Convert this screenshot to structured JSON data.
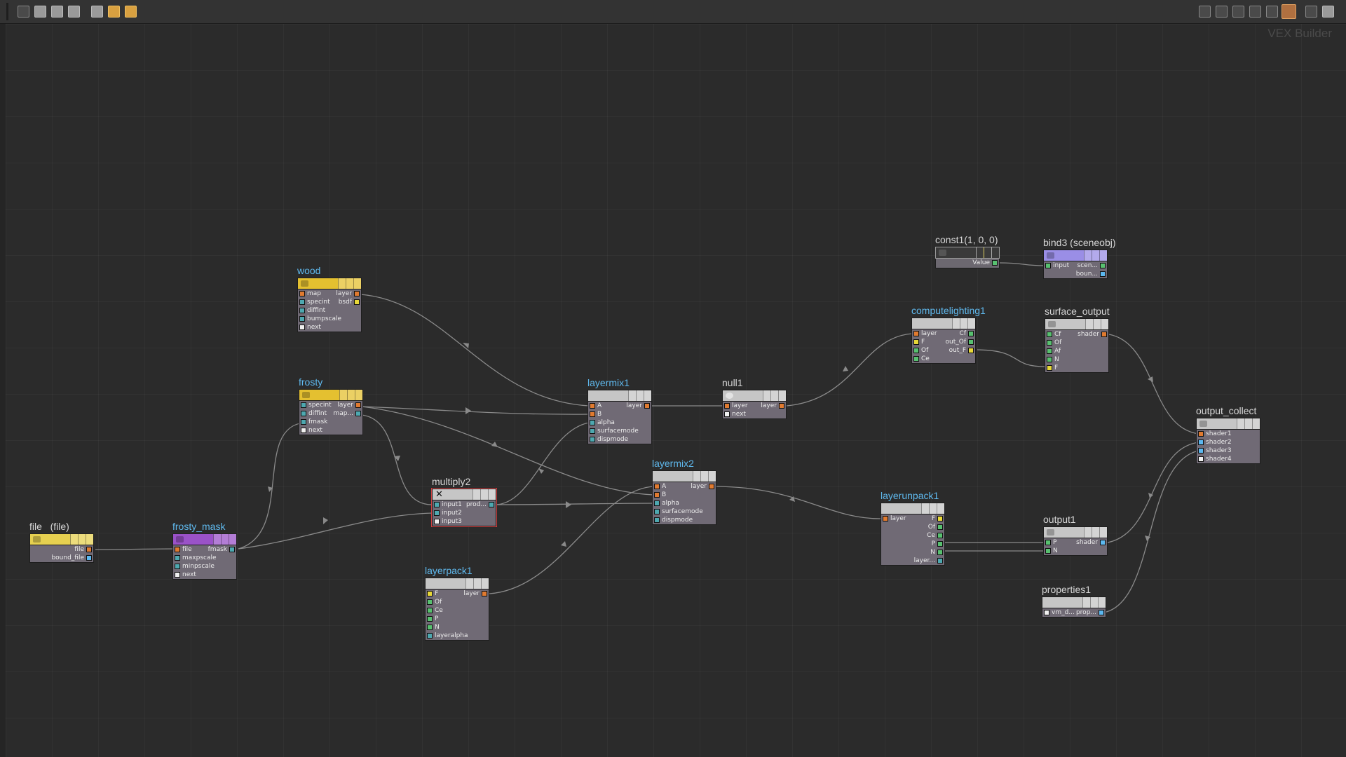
{
  "app": {
    "context_label": "VEX Builder"
  },
  "toolbar": {
    "left_icons": [
      "tree-view-icon",
      "list-view-icon",
      "parameter-view-icon",
      "grid-view-icon",
      "network-box-icon",
      "sticky-note-icon",
      "shelf-icon"
    ],
    "right_icons": [
      "layout-vertical-icon",
      "layout-horizontal-icon",
      "layout-branch-icon",
      "layout-flow-icon",
      "grid-snap-icon",
      "color-palette-icon",
      "zoom-icon",
      "snapshot-icon"
    ]
  },
  "colors": {
    "background": "#2b2b2b",
    "title_blue": "#5fb9ee",
    "wood_header": "#e4c030",
    "mask_header": "#9a52c8",
    "bind_header": "#9a8ee6",
    "selected_border": "#d04040"
  },
  "nodes": {
    "file": {
      "title": "file",
      "subtitle": "(file)",
      "inputs": [],
      "outputs": [
        "file",
        "bound_file"
      ]
    },
    "frosty_mask": {
      "title": "frosty_mask",
      "inputs": [
        "file",
        "maxpscale",
        "minpscale",
        "next"
      ],
      "outputs": [
        "fmask"
      ]
    },
    "wood": {
      "title": "wood",
      "inputs": [
        "map",
        "specint",
        "diffint",
        "bumpscale",
        "next"
      ],
      "outputs": [
        "layer",
        "bsdf"
      ]
    },
    "frosty": {
      "title": "frosty",
      "inputs": [
        "specint",
        "diffint",
        "fmask",
        "next"
      ],
      "outputs": [
        "layer",
        "map..."
      ]
    },
    "multiply2": {
      "title": "multiply2",
      "inputs": [
        "input1",
        "input2",
        "input3"
      ],
      "outputs": [
        "prod..."
      ]
    },
    "layerpack1": {
      "title": "layerpack1",
      "inputs": [
        "F",
        "Of",
        "Ce",
        "P",
        "N",
        "layeralpha"
      ],
      "outputs": [
        "layer"
      ]
    },
    "layermix1": {
      "title": "layermix1",
      "inputs": [
        "A",
        "B",
        "alpha",
        "surfacemode",
        "dispmode"
      ],
      "outputs": [
        "layer"
      ]
    },
    "layermix2": {
      "title": "layermix2",
      "inputs": [
        "A",
        "B",
        "alpha",
        "surfacemode",
        "dispmode"
      ],
      "outputs": [
        "layer"
      ]
    },
    "null1": {
      "title": "null1",
      "inputs": [
        "layer",
        "next"
      ],
      "outputs": [
        "layer"
      ]
    },
    "computelighting1": {
      "title": "computelighting1",
      "inputs": [
        "layer",
        "F",
        "Of",
        "Ce"
      ],
      "outputs": [
        "Cf",
        "out_Of",
        "out_F"
      ]
    },
    "const1": {
      "title": "const1",
      "subtitle": "(1, 0, 0)",
      "outputs": [
        "Value"
      ]
    },
    "bind3": {
      "title": "bind3",
      "subtitle": "(sceneobj)",
      "inputs": [
        "input"
      ],
      "outputs": [
        "scen...",
        "boun..."
      ]
    },
    "surface_output": {
      "title": "surface_output",
      "inputs": [
        "Cf",
        "Of",
        "Af",
        "N",
        "F"
      ],
      "outputs": [
        "shader"
      ]
    },
    "layerunpack1": {
      "title": "layerunpack1",
      "inputs": [
        "layer"
      ],
      "outputs": [
        "F",
        "Of",
        "Ce",
        "P",
        "N",
        "layer..."
      ]
    },
    "output1": {
      "title": "output1",
      "inputs": [
        "P",
        "N"
      ],
      "outputs": [
        "shader"
      ]
    },
    "properties1": {
      "title": "properties1",
      "inputs": [
        "vm_d..."
      ],
      "outputs": [
        "prop..."
      ]
    },
    "output_collect": {
      "title": "output_collect",
      "inputs": [
        "shader1",
        "shader2",
        "shader3",
        "shader4"
      ],
      "outputs": []
    }
  }
}
